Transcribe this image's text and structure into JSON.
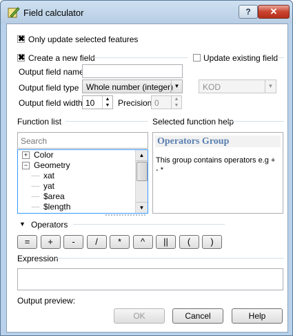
{
  "window": {
    "title": "Field calculator",
    "help_glyph": "?",
    "close_glyph": "✕"
  },
  "options": {
    "only_selected_label": "Only update selected features",
    "only_selected_checked": true,
    "create_new_label": "Create a new field",
    "create_new_checked": true,
    "update_existing_label": "Update existing field",
    "update_existing_checked": false
  },
  "new_field": {
    "name_label": "Output field name",
    "name_value": "",
    "type_label": "Output field type",
    "type_value": "Whole number (integer)",
    "width_label": "Output field width",
    "width_value": "10",
    "precision_label": "Precision",
    "precision_value": "0"
  },
  "existing_field": {
    "selected": "KOD"
  },
  "function_list": {
    "label": "Function list",
    "search_placeholder": "Search",
    "items": [
      {
        "label": "Color",
        "expander": "+"
      },
      {
        "label": "Geometry",
        "expander": "−"
      },
      {
        "label": "xat",
        "expander": ""
      },
      {
        "label": "yat",
        "expander": ""
      },
      {
        "label": "$area",
        "expander": ""
      },
      {
        "label": "$length",
        "expander": ""
      }
    ]
  },
  "function_help": {
    "label": "Selected function help",
    "heading": "Operators Group",
    "body": "This group contains operators e.g + - *"
  },
  "operators": {
    "label": "Operators",
    "buttons": [
      "=",
      "+",
      "-",
      "/",
      "*",
      "^",
      "||",
      "(",
      ")"
    ]
  },
  "expression": {
    "label": "Expression",
    "value": ""
  },
  "output_preview": {
    "label": "Output preview:"
  },
  "buttons": {
    "ok": "OK",
    "cancel": "Cancel",
    "help": "Help"
  }
}
